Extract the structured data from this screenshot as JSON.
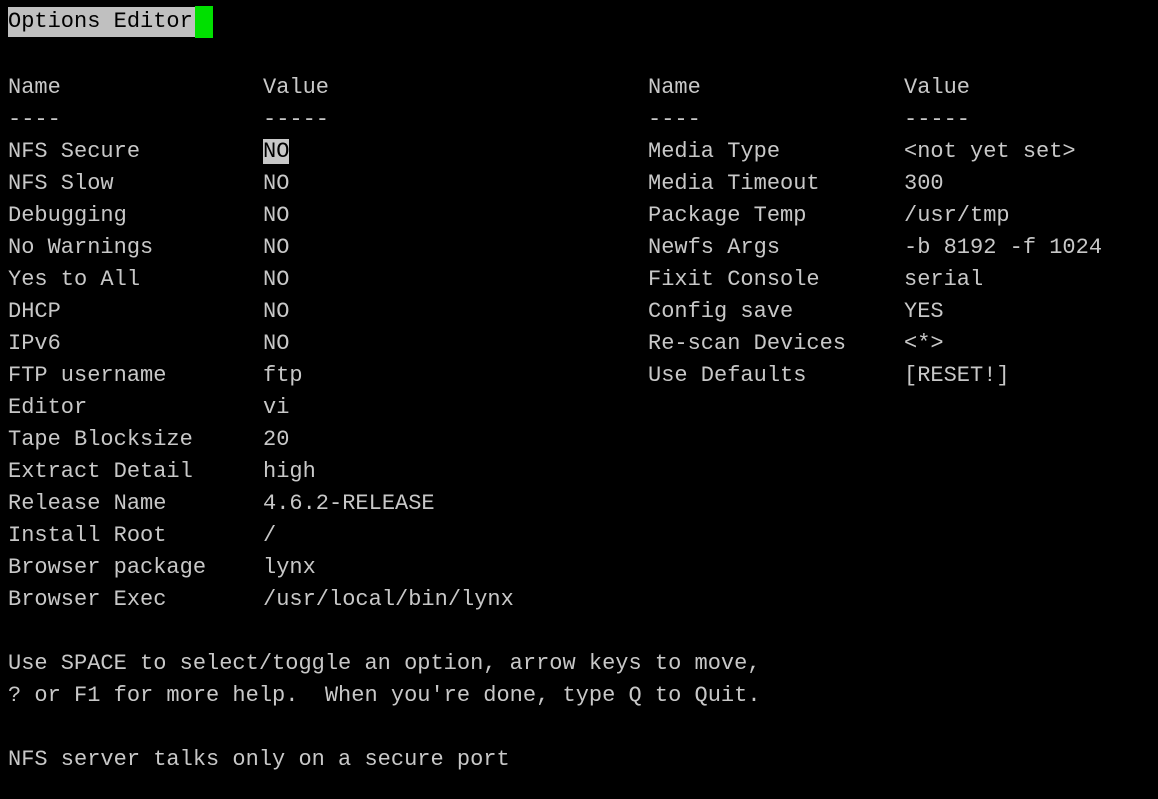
{
  "title": "Options Editor",
  "colors": {
    "background": "#000000",
    "text": "#c8c8c8",
    "title_bg": "#c0c0c0",
    "cursor": "#00e000",
    "highlight_bg": "#c8c8c8"
  },
  "headers": {
    "name": "Name",
    "value": "Value",
    "name_rule": "----",
    "value_rule": "-----"
  },
  "left_options": [
    {
      "name": "NFS Secure",
      "value": "NO"
    },
    {
      "name": "NFS Slow",
      "value": "NO"
    },
    {
      "name": "Debugging",
      "value": "NO"
    },
    {
      "name": "No Warnings",
      "value": "NO"
    },
    {
      "name": "Yes to All",
      "value": "NO"
    },
    {
      "name": "DHCP",
      "value": "NO"
    },
    {
      "name": "IPv6",
      "value": "NO"
    },
    {
      "name": "FTP username",
      "value": "ftp"
    },
    {
      "name": "Editor",
      "value": "vi"
    },
    {
      "name": "Tape Blocksize",
      "value": "20"
    },
    {
      "name": "Extract Detail",
      "value": "high"
    },
    {
      "name": "Release Name",
      "value": "4.6.2-RELEASE"
    },
    {
      "name": "Install Root",
      "value": "/"
    },
    {
      "name": "Browser package",
      "value": "lynx"
    },
    {
      "name": "Browser Exec",
      "value": "/usr/local/bin/lynx"
    }
  ],
  "right_options": [
    {
      "name": "Media Type",
      "value": "<not yet set>"
    },
    {
      "name": "Media Timeout",
      "value": "300"
    },
    {
      "name": "Package Temp",
      "value": "/usr/tmp"
    },
    {
      "name": "Newfs Args",
      "value": "-b 8192 -f 1024"
    },
    {
      "name": "Fixit Console",
      "value": "serial"
    },
    {
      "name": "Config save",
      "value": "YES"
    },
    {
      "name": "Re-scan Devices",
      "value": "<*>"
    },
    {
      "name": "Use Defaults",
      "value": "[RESET!]"
    }
  ],
  "help": {
    "line1": "Use SPACE to select/toggle an option, arrow keys to move,",
    "line2": "? or F1 for more help.  When you're done, type Q to Quit."
  },
  "status": "NFS server talks only on a secure port"
}
